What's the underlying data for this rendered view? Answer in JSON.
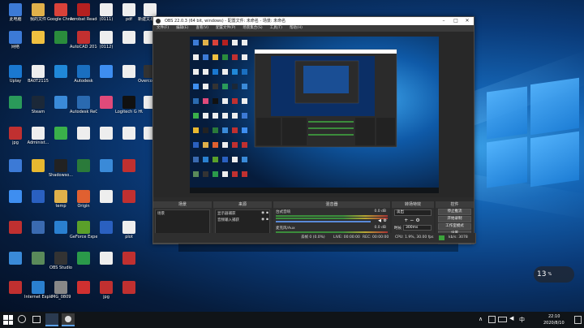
{
  "desktop": {
    "icons": [
      {
        "label": "此电脑",
        "color": "#3c7ad6"
      },
      {
        "label": "我的文件",
        "color": "#e0b04a"
      },
      {
        "label": "Google Chrome",
        "color": "#d9423a"
      },
      {
        "label": "Acrobat Reader DC",
        "color": "#b42020"
      },
      {
        "label": "(0111)",
        "color": "#eeeeee"
      },
      {
        "label": "pdf",
        "color": "#eeeeee"
      },
      {
        "label": "新建文本文档",
        "color": "#eeeeee"
      },
      {
        "label": "网络",
        "color": "#3c7ad6"
      },
      {
        "label": "",
        "color": "#f0c040"
      },
      {
        "label": "",
        "color": "#2a8c3c"
      },
      {
        "label": "AutoCAD 2014",
        "color": "#c23030"
      },
      {
        "label": "(0112)",
        "color": "#eeeeee"
      },
      {
        "label": "",
        "color": "#eeeeee"
      },
      {
        "label": "",
        "color": "#eeeeee"
      },
      {
        "label": "Uplay",
        "color": "#1a78d0"
      },
      {
        "label": "BA0T2115",
        "color": "#eeeeee"
      },
      {
        "label": "",
        "color": "#2088d8"
      },
      {
        "label": "Autodesk",
        "color": "#1a6fc0"
      },
      {
        "label": "",
        "color": "#3e8ef0"
      },
      {
        "label": "",
        "color": "#eeeeee"
      },
      {
        "label": "Overcooked",
        "color": "#333333"
      },
      {
        "label": "",
        "color": "#2a9a5a"
      },
      {
        "label": "Steam",
        "color": "#1b2838"
      },
      {
        "label": "",
        "color": "#3a8ad8"
      },
      {
        "label": "Autodesk ReCap",
        "color": "#2a6ab0"
      },
      {
        "label": "",
        "color": "#e04a7a"
      },
      {
        "label": "Logitech G HUB",
        "color": "#111111"
      },
      {
        "label": "",
        "color": "#eeeeee"
      },
      {
        "label": "jpg",
        "color": "#c03030"
      },
      {
        "label": "Administ...",
        "color": "#eeeeee"
      },
      {
        "label": "",
        "color": "#3ab04a"
      },
      {
        "label": "",
        "color": "#eeeeee"
      },
      {
        "label": "",
        "color": "#eeeeee"
      },
      {
        "label": "",
        "color": "#eeeeee"
      },
      {
        "label": "",
        "color": "#eeeeee"
      },
      {
        "label": "",
        "color": "#3c7ad6"
      },
      {
        "label": "",
        "color": "#e8b830"
      },
      {
        "label": "Shadowso...",
        "color": "#222222"
      },
      {
        "label": "",
        "color": "#2a7a3a"
      },
      {
        "label": "",
        "color": "#3a8ad8"
      },
      {
        "label": "",
        "color": "#c03030"
      },
      {
        "label": "",
        "color": "#3e8ef0"
      },
      {
        "label": "",
        "color": "#2a60c0"
      },
      {
        "label": "temp",
        "color": "#e0b04a"
      },
      {
        "label": "Origin",
        "color": "#e06030"
      },
      {
        "label": "",
        "color": "#eeeeee"
      },
      {
        "label": "",
        "color": "#c03030"
      },
      {
        "label": "",
        "color": "#c03030"
      },
      {
        "label": "",
        "color": "#3a6ab0"
      },
      {
        "label": "",
        "color": "#2a80d0"
      },
      {
        "label": "GeForce Experience",
        "color": "#5aa02a"
      },
      {
        "label": "",
        "color": "#2a60c0"
      },
      {
        "label": "plot",
        "color": "#eeeeee"
      },
      {
        "label": "",
        "color": "#3a8ad8"
      },
      {
        "label": "",
        "color": "#5a8a5a"
      },
      {
        "label": "OBS Studio",
        "color": "#333333"
      },
      {
        "label": "",
        "color": "#2a9a4a"
      },
      {
        "label": "",
        "color": "#eeeeee"
      },
      {
        "label": "",
        "color": "#c03030"
      },
      {
        "label": "",
        "color": "#c03030"
      },
      {
        "label": "Internet Explorer",
        "color": "#2a80d0"
      },
      {
        "label": "IMG_0809",
        "color": "#888888"
      },
      {
        "label": "",
        "color": "#d03030"
      },
      {
        "label": "jpg",
        "color": "#c03030"
      },
      {
        "label": "",
        "color": "#c03030"
      }
    ]
  },
  "obs": {
    "title": "OBS 22.0.3 (64 bit, windows) - 配置文件: 未命名 - 场景: 未命名",
    "menu": [
      "文件(F)",
      "编辑(E)",
      "查看(V)",
      "配置文件(P)",
      "场景集合(S)",
      "工具(T)",
      "帮助(H)"
    ],
    "docks": {
      "scenes": {
        "title": "场景",
        "items": [
          "场景"
        ]
      },
      "sources": {
        "title": "来源",
        "items": [
          "显示器捕获",
          "音频输入捕获"
        ]
      },
      "mixer": {
        "title": "混音器",
        "channels": [
          {
            "name": "台式音响",
            "db": "0.0 dB"
          },
          {
            "name": "麦克风/Aux",
            "db": "0.0 dB"
          }
        ]
      },
      "transitions": {
        "title": "转场特效",
        "type": "淡出",
        "duration_label": "时长",
        "duration": "300ms"
      },
      "controls": {
        "title": "控件",
        "buttons": [
          "停止推流",
          "开始录制",
          "工作室模式",
          "设置",
          "退出"
        ]
      }
    },
    "status": {
      "dropped": "丢帧 0 (0.0%)",
      "live": "LIVE: 00:00:00",
      "rec": "REC: 00:00:00",
      "cpu": "CPU: 1.9%, 30.00 fps",
      "kbps": "kb/s: 3078"
    },
    "accent": "#3ba33b"
  },
  "notification": {
    "text": "13",
    "unit": "%"
  },
  "taskbar": {
    "time": "22:10",
    "date": "2020/8/10",
    "lang": "中"
  }
}
